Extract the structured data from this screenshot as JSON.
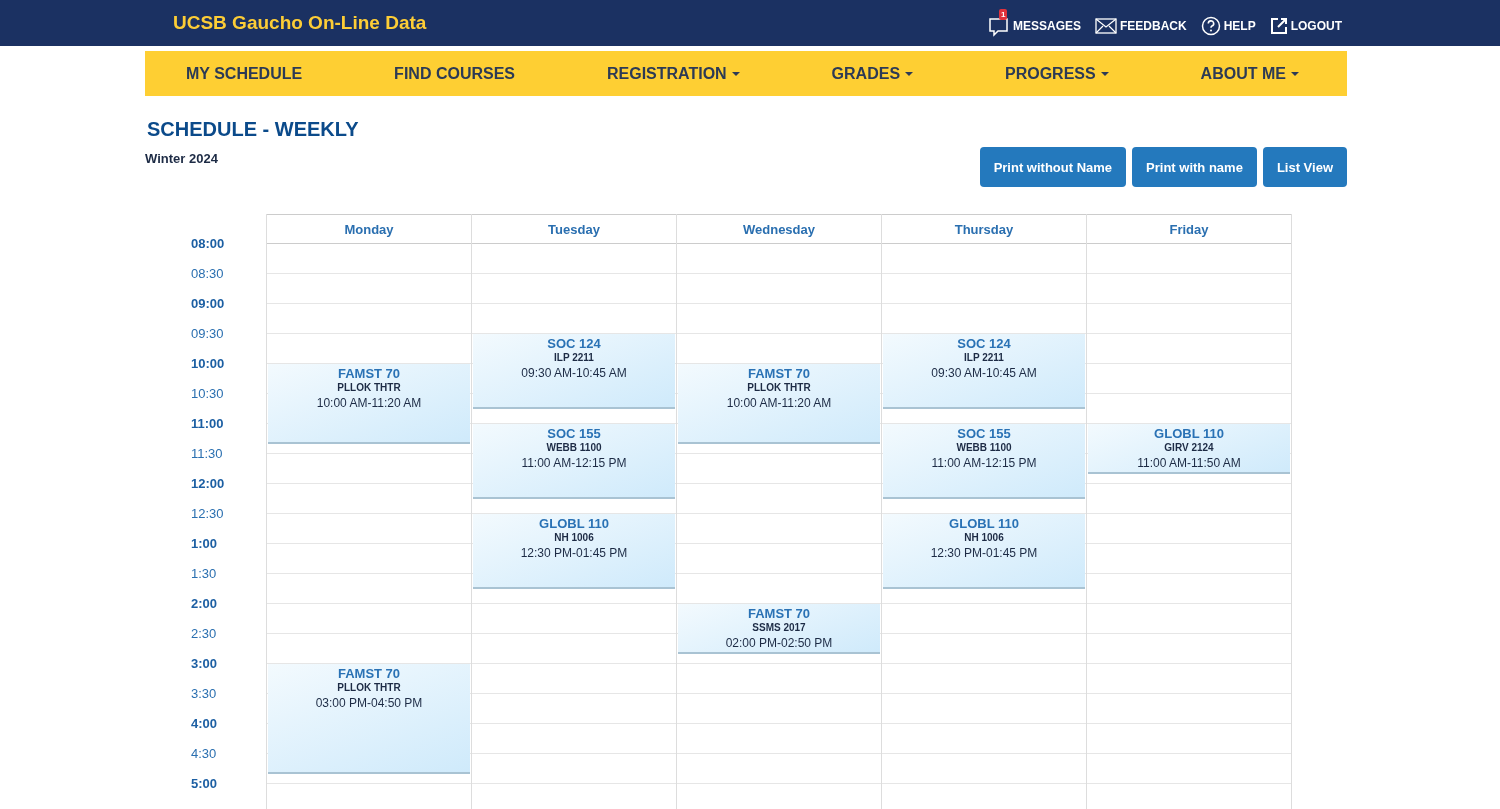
{
  "header": {
    "title": "UCSB Gaucho On-Line Data",
    "links": [
      {
        "kind": "messages",
        "label": "MESSAGES",
        "badge": "1"
      },
      {
        "kind": "feedback",
        "label": "FEEDBACK"
      },
      {
        "kind": "help",
        "label": "HELP"
      },
      {
        "kind": "logout",
        "label": "LOGOUT"
      }
    ]
  },
  "nav": [
    {
      "label": "MY SCHEDULE",
      "dropdown": false
    },
    {
      "label": "FIND COURSES",
      "dropdown": false
    },
    {
      "label": "REGISTRATION",
      "dropdown": true
    },
    {
      "label": "GRADES",
      "dropdown": true
    },
    {
      "label": "PROGRESS",
      "dropdown": true
    },
    {
      "label": "ABOUT ME",
      "dropdown": true
    }
  ],
  "page_title": "SCHEDULE - WEEKLY",
  "term": "Winter 2024",
  "buttons": [
    "Print without Name",
    "Print with name",
    "List View"
  ],
  "times": [
    {
      "label": "08:00",
      "kind": "hour"
    },
    {
      "label": "08:30",
      "kind": "half"
    },
    {
      "label": "09:00",
      "kind": "hour"
    },
    {
      "label": "09:30",
      "kind": "half"
    },
    {
      "label": "10:00",
      "kind": "hour"
    },
    {
      "label": "10:30",
      "kind": "half"
    },
    {
      "label": "11:00",
      "kind": "hour"
    },
    {
      "label": "11:30",
      "kind": "half"
    },
    {
      "label": "12:00",
      "kind": "hour"
    },
    {
      "label": "12:30",
      "kind": "half"
    },
    {
      "label": "1:00",
      "kind": "hour"
    },
    {
      "label": "1:30",
      "kind": "half"
    },
    {
      "label": "2:00",
      "kind": "hour"
    },
    {
      "label": "2:30",
      "kind": "half"
    },
    {
      "label": "3:00",
      "kind": "hour"
    },
    {
      "label": "3:30",
      "kind": "half"
    },
    {
      "label": "4:00",
      "kind": "hour"
    },
    {
      "label": "4:30",
      "kind": "half"
    },
    {
      "label": "5:00",
      "kind": "hour"
    }
  ],
  "days": [
    {
      "name": "Monday",
      "events": [
        {
          "course": "FAMST 70",
          "room": "PLLOK THTR",
          "time": "10:00 AM-11:20 AM"
        },
        {
          "course": "FAMST 70",
          "room": "PLLOK THTR",
          "time": "03:00 PM-04:50 PM"
        }
      ]
    },
    {
      "name": "Tuesday",
      "events": [
        {
          "course": "SOC 124",
          "room": "ILP 2211",
          "time": "09:30 AM-10:45 AM"
        },
        {
          "course": "SOC 155",
          "room": "WEBB 1100",
          "time": "11:00 AM-12:15 PM"
        },
        {
          "course": "GLOBL 110",
          "room": "NH 1006",
          "time": "12:30 PM-01:45 PM"
        }
      ]
    },
    {
      "name": "Wednesday",
      "events": [
        {
          "course": "FAMST 70",
          "room": "PLLOK THTR",
          "time": "10:00 AM-11:20 AM"
        },
        {
          "course": "FAMST 70",
          "room": "SSMS 2017",
          "time": "02:00 PM-02:50 PM"
        }
      ]
    },
    {
      "name": "Thursday",
      "events": [
        {
          "course": "SOC 124",
          "room": "ILP 2211",
          "time": "09:30 AM-10:45 AM"
        },
        {
          "course": "SOC 155",
          "room": "WEBB 1100",
          "time": "11:00 AM-12:15 PM"
        },
        {
          "course": "GLOBL 110",
          "room": "NH 1006",
          "time": "12:30 PM-01:45 PM"
        }
      ]
    },
    {
      "name": "Friday",
      "events": [
        {
          "course": "GLOBL 110",
          "room": "GIRV 2124",
          "time": "11:00 AM-11:50 AM"
        }
      ]
    }
  ]
}
